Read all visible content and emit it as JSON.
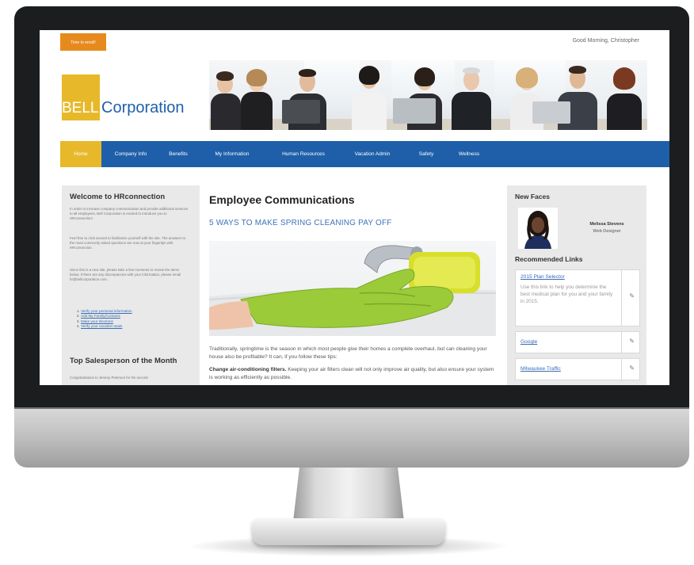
{
  "topbar": {
    "cta_label": "Time to enroll!",
    "greeting": "Good Morning, Christopher"
  },
  "logo": {
    "bell": "BELL",
    "corporation": "Corporation"
  },
  "nav": {
    "items": [
      "Home",
      "Company Info",
      "Benefits",
      "My Information",
      "Human Resources",
      "Vacation Admin",
      "Safety",
      "Wellness"
    ],
    "active": "Home"
  },
  "left": {
    "title": "Welcome to HRconnection",
    "paragraphs": [
      "In order to increase company communication and provide additional services to all employees, Bell Corporation is excited to introduce you to HRconnection!",
      "Feel free to click around to familiarize yourself with the site. The answers to the most commonly asked questions are now at your fingertips with HRconnection.",
      "Since this is a new site, please take a few moments to review the items below. If there are any discrepancies with your information, please email hr@bellcorporation.com."
    ],
    "tasks": [
      "Verify your personal information",
      "Add My Family/Contacts",
      "Make your elections",
      "Verify your vacation totals"
    ],
    "title2": "Top Salesperson of the Month",
    "para2": "Congratulations to Jeremy Peterson for his second"
  },
  "main": {
    "title": "Employee Communications",
    "subtitle": "5 WAYS TO MAKE SPRING CLEANING PAY OFF",
    "p1": "Traditionally, springtime is the season in which most people give their homes a complete overhaul, but can cleaning your house also be profitable? It can, if you follow these tips:",
    "p2_bold": "Change air-conditioning filters.",
    "p2_rest": " Keeping your air filters clean will not only improve air quality, but also ensure your system is working as efficiently as possible."
  },
  "right": {
    "new_faces_title": "New Faces",
    "person_name": "Melissa Stevens",
    "person_role": "Web Designer",
    "links_title": "Recommended Links",
    "links": [
      {
        "label": "2015 Plan Selector",
        "desc": "Use this link to help you determine the best medical plan for you and your family in 2015."
      },
      {
        "label": "Google",
        "desc": ""
      },
      {
        "label": "Milwaukee Traffic",
        "desc": ""
      }
    ],
    "edit_icon": "pencil-icon"
  },
  "colors": {
    "nav_blue": "#1f5fa9",
    "accent_gold": "#e7b92a",
    "cta_orange": "#e78a1e",
    "link_blue": "#3a6db5"
  }
}
